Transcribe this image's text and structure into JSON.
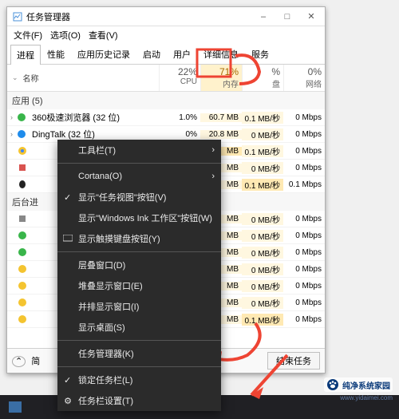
{
  "window": {
    "title": "任务管理器",
    "menu": {
      "file": "文件(F)",
      "options": "选项(O)",
      "view": "查看(V)"
    },
    "win_buttons": {
      "min": "–",
      "max": "□",
      "close": "✕"
    }
  },
  "tabs": [
    "进程",
    "性能",
    "应用历史记录",
    "启动",
    "用户",
    "详细信息",
    "服务"
  ],
  "columns": {
    "name": "名称",
    "cpu": {
      "pct": "22%",
      "label": "CPU"
    },
    "mem": {
      "pct": "71%",
      "label": "内存"
    },
    "disk": {
      "pct": "%",
      "label": "盘"
    },
    "net": {
      "pct": "0%",
      "label": "网络"
    }
  },
  "groups": {
    "apps": "应用 (5)",
    "bg": "后台进"
  },
  "rows": [
    {
      "name": "360极速浏览器 (32 位)",
      "cpu": "1.0%",
      "mem": "60.7 MB",
      "disk": "0.1 MB/秒",
      "net": "0 Mbps"
    },
    {
      "name": "DingTalk (32 位)",
      "cpu": "0%",
      "mem": "20.8 MB",
      "disk": "0 MB/秒",
      "net": "0 Mbps"
    },
    {
      "name": "",
      "cpu": "",
      "mem": "MB",
      "disk": "0.1 MB/秒",
      "net": "0 Mbps"
    },
    {
      "name": "",
      "cpu": "",
      "mem": "MB",
      "disk": "0 MB/秒",
      "net": "0 Mbps"
    },
    {
      "name": "",
      "cpu": "",
      "mem": "MB",
      "disk": "0.1 MB/秒",
      "net": "0.1 Mbps"
    },
    {
      "name": "",
      "cpu": "",
      "mem": "MB",
      "disk": "0 MB/秒",
      "net": "0 Mbps"
    },
    {
      "name": "",
      "cpu": "",
      "mem": "MB",
      "disk": "0 MB/秒",
      "net": "0 Mbps"
    },
    {
      "name": "",
      "cpu": "",
      "mem": "MB",
      "disk": "0 MB/秒",
      "net": "0 Mbps"
    },
    {
      "name": "",
      "cpu": "",
      "mem": "MB",
      "disk": "0 MB/秒",
      "net": "0 Mbps"
    },
    {
      "name": "",
      "cpu": "",
      "mem": "MB",
      "disk": "0 MB/秒",
      "net": "0 Mbps"
    },
    {
      "name": "",
      "cpu": "",
      "mem": "MB",
      "disk": "0 MB/秒",
      "net": "0 Mbps"
    },
    {
      "name": "",
      "cpu": "",
      "mem": "MB",
      "disk": "0.1 MB/秒",
      "net": "0 Mbps"
    }
  ],
  "statusbar": {
    "details": "简",
    "endtask": "结束任务"
  },
  "contextmenu": {
    "toolbars": "工具栏(T)",
    "cortana": "Cortana(O)",
    "show_taskview": "显示\"任务视图\"按钮(V)",
    "show_ink": "显示\"Windows Ink 工作区\"按钮(W)",
    "show_touchkb": "显示触摸键盘按钮(Y)",
    "cascade": "层叠窗口(D)",
    "stacked": "堆叠显示窗口(E)",
    "sidebyside": "并排显示窗口(I)",
    "show_desktop": "显示桌面(S)",
    "task_manager": "任务管理器(K)",
    "lock_taskbar": "锁定任务栏(L)",
    "taskbar_settings": "任务栏设置(T)"
  },
  "watermark": {
    "brand": "纯净系统家园",
    "url": "www.yidaimei.com"
  }
}
